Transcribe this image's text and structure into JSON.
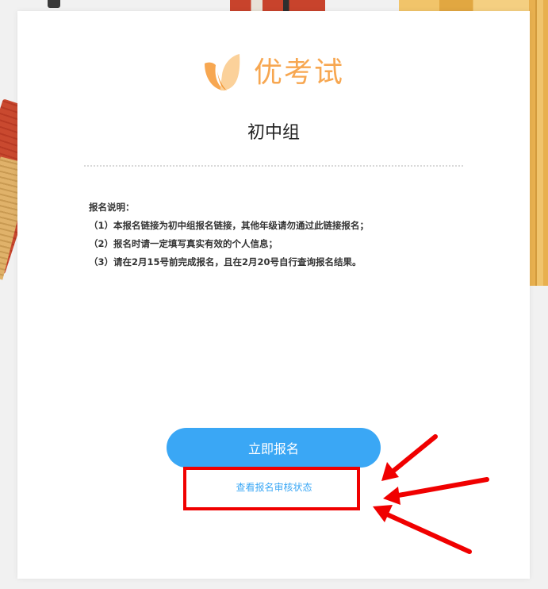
{
  "brand": {
    "logo_text": "优考试",
    "accent_color": "#f7a751"
  },
  "page": {
    "group_title": "初中组"
  },
  "notes": {
    "heading": "报名说明：",
    "items": [
      "（1）本报名链接为初中组报名链接，其他年级请勿通过此链接报名；",
      "（2）报名时请一定填写真实有效的个人信息；",
      "（3）请在2月15号前完成报名，且在2月20号自行查询报名结果。"
    ]
  },
  "actions": {
    "signup_label": "立即报名",
    "status_link_label": "查看报名审核状态",
    "primary_color": "#3aa7f5"
  },
  "annotation": {
    "highlight_color": "#f00000"
  }
}
